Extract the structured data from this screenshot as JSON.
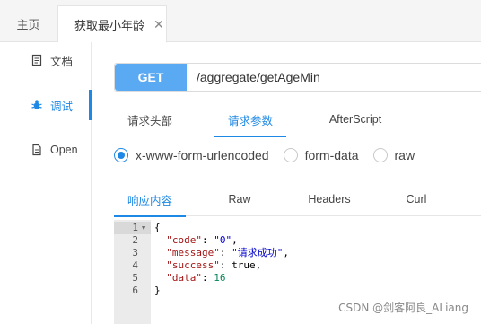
{
  "tabs": {
    "home": "主页",
    "active": "获取最小年龄",
    "close": "✕"
  },
  "sidebar": {
    "items": [
      {
        "label": "文档",
        "icon": "document-icon"
      },
      {
        "label": "调试",
        "icon": "bug-icon"
      },
      {
        "label": "Open",
        "icon": "file-icon"
      }
    ]
  },
  "request": {
    "method": "GET",
    "url": "/aggregate/getAgeMin",
    "tabs": [
      "请求头部",
      "请求参数",
      "AfterScript"
    ],
    "active_tab": "请求参数"
  },
  "body_type": {
    "options": [
      "x-www-form-urlencoded",
      "form-data",
      "raw"
    ],
    "selected": "x-www-form-urlencoded"
  },
  "response": {
    "tabs": [
      "响应内容",
      "Raw",
      "Headers",
      "Curl"
    ],
    "active_tab": "响应内容",
    "line_numbers": [
      "1",
      "2",
      "3",
      "4",
      "5",
      "6"
    ],
    "lines": {
      "l1": "{",
      "l2_key": "\"code\"",
      "l2_val": "\"0\"",
      "l3_key": "\"message\"",
      "l3_val": "\"请求成功\"",
      "l4_key": "\"success\"",
      "l4_val": "true",
      "l5_key": "\"data\"",
      "l5_val": "16",
      "l6": "}"
    }
  },
  "watermark": "CSDN @剑客阿良_ALiang",
  "colors": {
    "accent": "#1e88e5",
    "method_bg": "#5aa9f3"
  }
}
